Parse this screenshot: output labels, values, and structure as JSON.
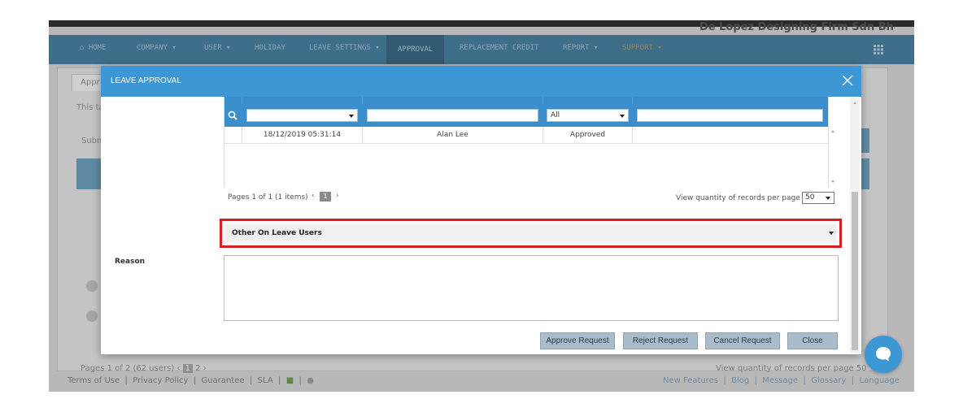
{
  "app": {
    "company_name": "De Lopez Designing Firm Sdn Bhd",
    "nav": [
      {
        "label": "HOME",
        "icon": "home-icon"
      },
      {
        "label": "COMPANY ▾"
      },
      {
        "label": "USER ▾"
      },
      {
        "label": "HOLIDAY"
      },
      {
        "label": "LEAVE SETTINGS ▾"
      },
      {
        "label": "APPROVAL"
      },
      {
        "label": "REPLACEMENT CREDIT"
      },
      {
        "label": "REPORT ▾"
      },
      {
        "label": "SUPPORT ▾"
      }
    ],
    "tab_label": "Appr",
    "bg_text_1": "This ta",
    "bg_text_2": "Subm",
    "bg_pager": "Pages 1 of 2 (62 users)",
    "bg_pager_pages": [
      "1",
      "2"
    ],
    "bg_records": "View quantity of records per page",
    "bg_records_value": "50",
    "footer_left": [
      "Terms of Use",
      "Privacy Policy",
      "Guarantee",
      "SLA"
    ],
    "footer_right": [
      "New Features",
      "Blog",
      "Message",
      "Glossary",
      "Language"
    ],
    "separator": "|"
  },
  "modal": {
    "title": "LEAVE APPROVAL",
    "grid": {
      "header_partial": "...",
      "filters": {
        "col1_value": "",
        "col3_value": "All"
      },
      "rows": [
        {
          "date": "18/12/2019 05:31:14",
          "user": "Alan Lee",
          "status": "Approved",
          "remarks": ""
        }
      ]
    },
    "pager": {
      "info": "Pages 1 of 1 (1 items)",
      "prev": "‹",
      "current": "1",
      "next": "›",
      "records_label": "View quantity of records per page",
      "records_value": "50"
    },
    "other_leave": {
      "label": "Other On Leave Users"
    },
    "reason": {
      "label": "Reason",
      "value": ""
    },
    "buttons": {
      "approve": "Approve Request",
      "reject": "Reject Request",
      "cancel": "Cancel Request",
      "close": "Close"
    }
  },
  "colors": {
    "header_blue": "#3e97d5",
    "highlight_red": "#d42020",
    "button": "#a9bccb"
  }
}
